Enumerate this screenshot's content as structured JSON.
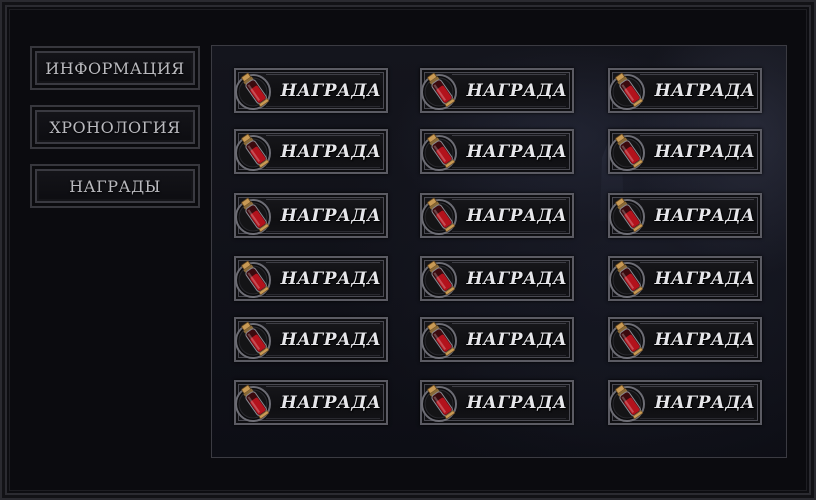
{
  "sidebar": {
    "tabs": [
      {
        "label": "ИНФОРМАЦИЯ"
      },
      {
        "label": "ХРОНОЛОГИЯ"
      },
      {
        "label": "НАГРАДЫ"
      }
    ]
  },
  "rewards": {
    "columns": 3,
    "rows": 6,
    "item_icon": "blood-vial-icon",
    "items": [
      {
        "label": "НАГРАДА"
      },
      {
        "label": "НАГРАДА"
      },
      {
        "label": "НАГРАДА"
      },
      {
        "label": "НАГРАДА"
      },
      {
        "label": "НАГРАДА"
      },
      {
        "label": "НАГРАДА"
      },
      {
        "label": "НАГРАДА"
      },
      {
        "label": "НАГРАДА"
      },
      {
        "label": "НАГРАДА"
      },
      {
        "label": "НАГРАДА"
      },
      {
        "label": "НАГРАДА"
      },
      {
        "label": "НАГРАДА"
      },
      {
        "label": "НАГРАДА"
      },
      {
        "label": "НАГРАДА"
      },
      {
        "label": "НАГРАДА"
      },
      {
        "label": "НАГРАДА"
      },
      {
        "label": "НАГРАДА"
      },
      {
        "label": "НАГРАДА"
      }
    ]
  },
  "colors": {
    "background": "#0b0b0f",
    "frame_border": "#3a3a41",
    "tab_text": "#b9b9be",
    "reward_text": "#e6e6ea",
    "vial_liquid": "#b3121c",
    "vial_cap": "#b58a4c"
  }
}
